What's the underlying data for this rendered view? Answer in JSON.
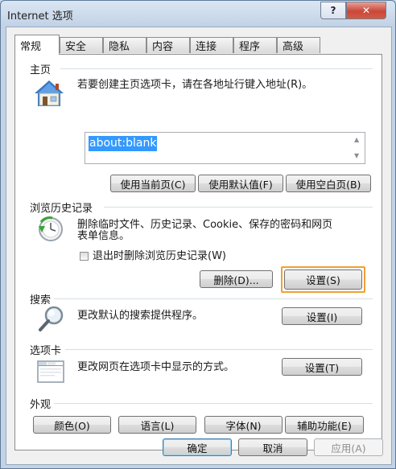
{
  "window": {
    "title": "Internet 选项"
  },
  "titlebar": {
    "help_glyph": "?",
    "close_glyph": "✕"
  },
  "tabs": [
    "常规",
    "安全",
    "隐私",
    "内容",
    "连接",
    "程序",
    "高级"
  ],
  "homepage": {
    "heading": "主页",
    "description": "若要创建主页选项卡，请在各地址行键入地址(R)。",
    "address": "about:blank",
    "btn_current": "使用当前页(C)",
    "btn_default": "使用默认值(F)",
    "btn_blank": "使用空白页(B)"
  },
  "history": {
    "heading": "浏览历史记录",
    "description_line1": "删除临时文件、历史记录、Cookie、保存的密码和网页",
    "description_line2": "表单信息。",
    "checkbox_label": "退出时删除浏览历史记录(W)",
    "checkbox_checked": false,
    "btn_delete": "删除(D)...",
    "btn_settings": "设置(S)"
  },
  "search": {
    "heading": "搜索",
    "description": "更改默认的搜索提供程序。",
    "btn_settings": "设置(I)"
  },
  "tabs_section": {
    "heading": "选项卡",
    "description": "更改网页在选项卡中显示的方式。",
    "btn_settings": "设置(T)"
  },
  "appearance": {
    "heading": "外观",
    "btn_colors": "颜色(O)",
    "btn_languages": "语言(L)",
    "btn_fonts": "字体(N)",
    "btn_accessibility": "辅助功能(E)"
  },
  "footer": {
    "ok": "确定",
    "cancel": "取消",
    "apply": "应用(A)"
  },
  "colors": {
    "selection": "#3399ff",
    "focus_ring": "#f0a035",
    "close_button": "#c9483a"
  }
}
